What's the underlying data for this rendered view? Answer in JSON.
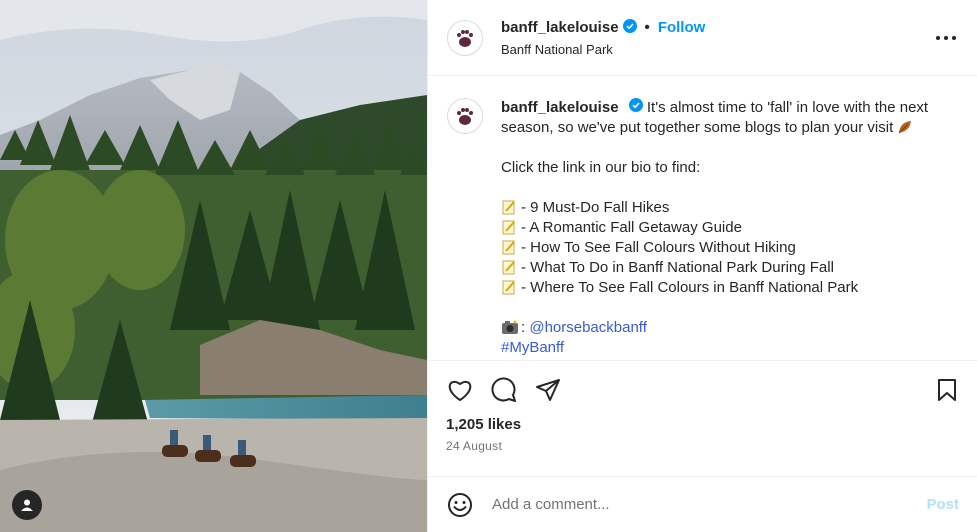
{
  "post": {
    "username": "banff_lakelouise",
    "follow_label": "Follow",
    "separator": "•",
    "location": "Banff National Park",
    "caption": {
      "text_line_1": "It's almost time to 'fall' in love with the next season, so we've put together some blogs to plan your visit",
      "text_line_2": "Click the link in our bio to find:",
      "list": [
        "- 9 Must-Do Fall Hikes",
        "- A Romantic Fall Getaway Guide",
        "- How To See Fall Colours Without Hiking",
        "- What To Do in Banff National Park During Fall",
        "- Where To See Fall Colours in Banff National Park"
      ],
      "credit_suffix": ":",
      "credit_handle": "@horsebackbanff",
      "hashtag": "#MyBanff"
    },
    "likes": "1,205 likes",
    "date": "24 August",
    "comment_placeholder": "Add a comment...",
    "post_label": "Post"
  },
  "icons": {
    "more": "more-icon",
    "verified": "verified-badge-icon",
    "like": "heart-icon",
    "comment": "comment-icon",
    "share": "share-icon",
    "save": "bookmark-icon",
    "emoji": "smile-icon",
    "user_tag": "user-tag-icon"
  },
  "colors": {
    "accent": "#0095f6",
    "verified": "#0095f6",
    "hashtag": "#3a5bd9",
    "post_disabled": "#b2dffc"
  }
}
